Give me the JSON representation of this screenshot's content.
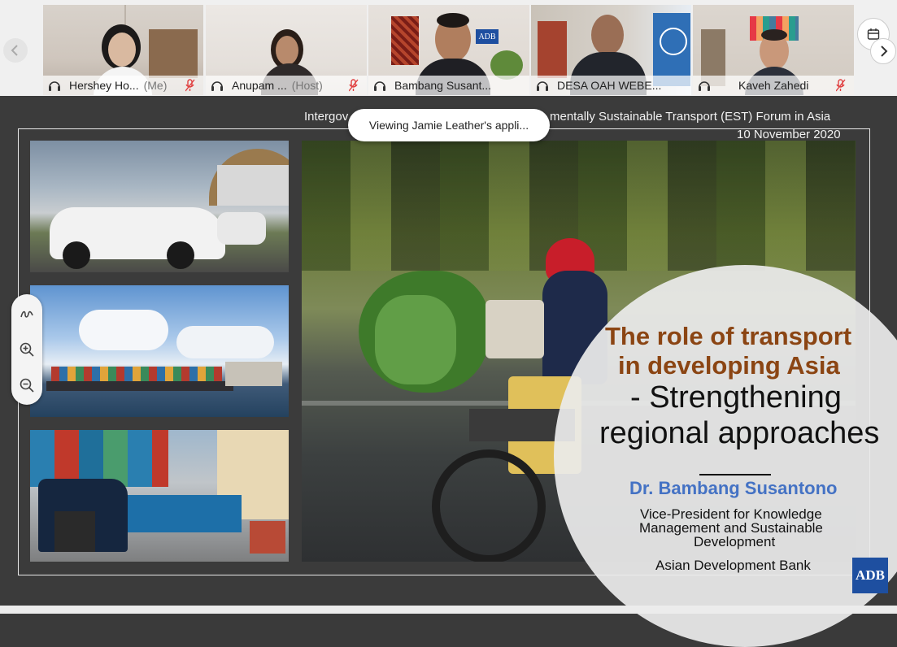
{
  "participants": [
    {
      "name": "Hershey Ho...",
      "role": "(Me)",
      "muted": true
    },
    {
      "name": "Anupam ...",
      "role": "(Host)",
      "muted": true
    },
    {
      "name": "Bambang Susant...",
      "role": "",
      "muted": false,
      "active": true
    },
    {
      "name": "DESA OAH WEBE...",
      "role": "",
      "muted": false
    },
    {
      "name": "Kaveh Zahedi",
      "role": "",
      "muted": true
    }
  ],
  "tile_labels": {
    "adb_sign": "ADB"
  },
  "viewing_notice": "Viewing Jamie Leather's appli...",
  "slide": {
    "header_left": "Intergov",
    "header_right": "mentally Sustainable Transport (EST) Forum in Asia",
    "date": "10 November 2020",
    "title_line1": "The role of transport",
    "title_line2": "in developing Asia",
    "subtitle_line1": "- Strengthening",
    "subtitle_line2": "regional approaches",
    "speaker_name": "Dr. Bambang Susantono",
    "speaker_title_line1": "Vice-President for Knowledge",
    "speaker_title_line2": "Management and Sustainable",
    "speaker_title_line3": "Development",
    "organization": "Asian Development Bank",
    "logo_text": "ADB"
  },
  "colors": {
    "accent": "#1aa3d9",
    "title": "#8b4513",
    "speaker": "#4472c4",
    "mute": "#e04040"
  },
  "icons": {
    "headphone": "headphone-icon",
    "mic_off": "mic-off-icon",
    "prev": "chevron-left-icon",
    "next": "chevron-right-icon",
    "calendar": "calendar-icon",
    "annotate": "annotate-icon",
    "zoom_in": "zoom-in-icon",
    "zoom_out": "zoom-out-icon"
  }
}
